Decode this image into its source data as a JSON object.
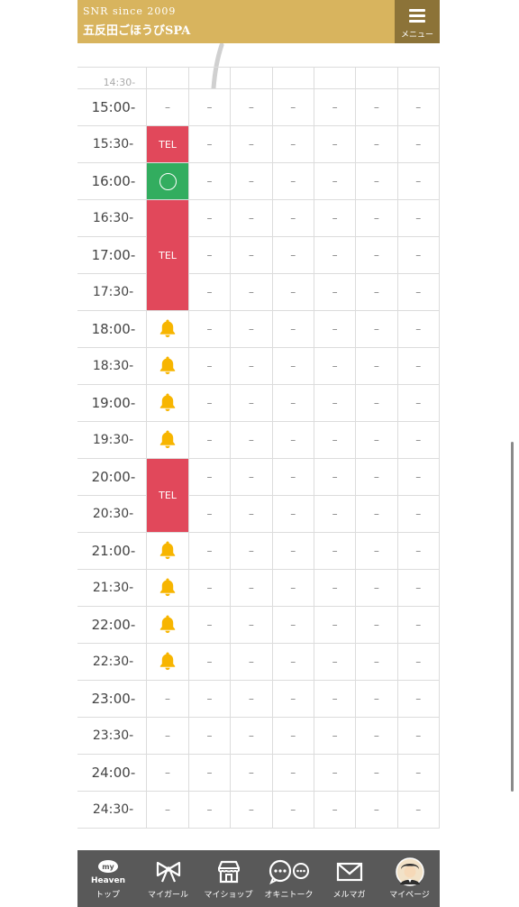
{
  "header": {
    "logo_line1": "SNR since 2009",
    "logo_line2": "五反田ごほうびSPA",
    "menu_label": "メニュー"
  },
  "schedule": {
    "top_partial_time": "14:30-",
    "dash": "–",
    "tel_label": "TEL",
    "rows": [
      {
        "time": "15:00-",
        "first": "dash"
      },
      {
        "time": "15:30-",
        "first": "tel"
      },
      {
        "time": "16:00-",
        "first": "ok"
      },
      {
        "time": "16:30-",
        "first": "tel_span3"
      },
      {
        "time": "17:00-",
        "first": "covered"
      },
      {
        "time": "17:30-",
        "first": "covered"
      },
      {
        "time": "18:00-",
        "first": "bell"
      },
      {
        "time": "18:30-",
        "first": "bell"
      },
      {
        "time": "19:00-",
        "first": "bell"
      },
      {
        "time": "19:30-",
        "first": "bell"
      },
      {
        "time": "20:00-",
        "first": "tel_span2"
      },
      {
        "time": "20:30-",
        "first": "covered"
      },
      {
        "time": "21:00-",
        "first": "bell"
      },
      {
        "time": "21:30-",
        "first": "bell"
      },
      {
        "time": "22:00-",
        "first": "bell"
      },
      {
        "time": "22:30-",
        "first": "bell"
      },
      {
        "time": "23:00-",
        "first": "dash"
      },
      {
        "time": "23:30-",
        "first": "dash"
      },
      {
        "time": "24:00-",
        "first": "dash"
      },
      {
        "time": "24:30-",
        "first": "dash"
      }
    ]
  },
  "colors": {
    "header_bg": "#d8b45e",
    "menu_bg": "#8c7338",
    "tel_red": "#e1485b",
    "available_green": "#32ad5f",
    "bell_yellow": "#f7b500",
    "nav_bg": "#595959"
  },
  "bottom_nav": [
    {
      "label": "トップ",
      "icon": "my-heaven-icon",
      "icon_text_top": "my",
      "icon_text_bottom": "Heaven"
    },
    {
      "label": "マイガール",
      "icon": "ribbon-icon"
    },
    {
      "label": "マイショップ",
      "icon": "shop-icon"
    },
    {
      "label": "オキニトーク",
      "icon": "chat-bubbles-icon"
    },
    {
      "label": "メルマガ",
      "icon": "mail-icon"
    },
    {
      "label": "マイページ",
      "icon": "avatar-icon"
    }
  ]
}
